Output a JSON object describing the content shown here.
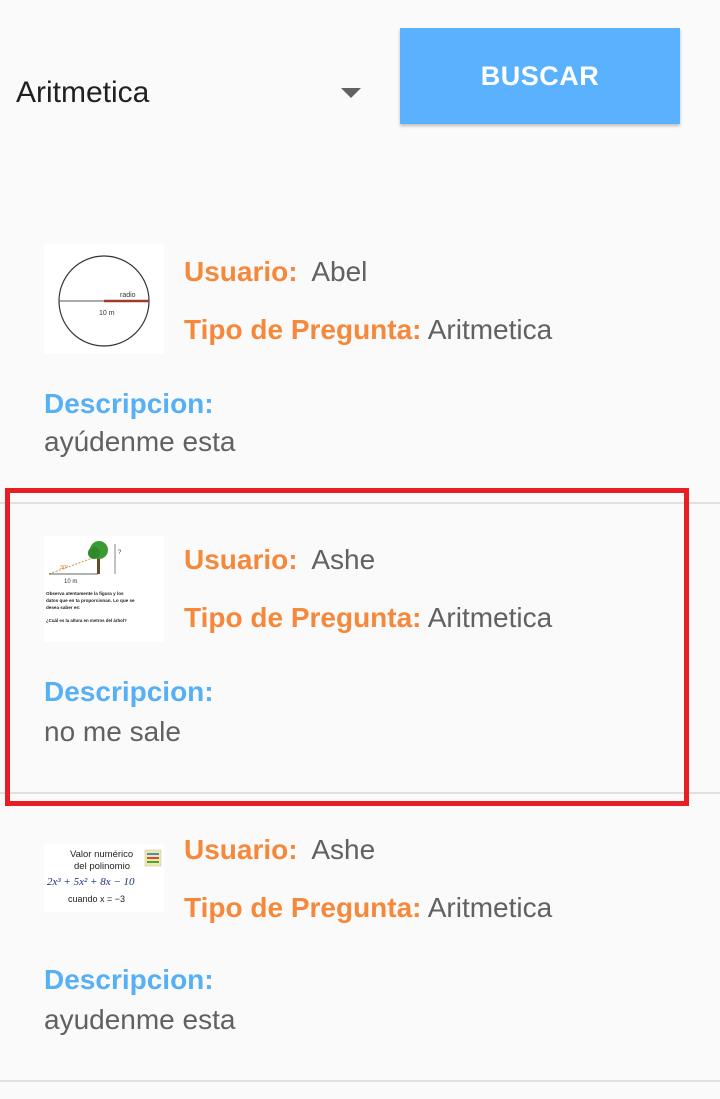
{
  "filter": {
    "selected": "Aritmetica",
    "button_label": "BUSCAR"
  },
  "labels": {
    "usuario": "Usuario:",
    "tipo": "Tipo de Pregunta:",
    "descripcion": "Descripcion:"
  },
  "posts": [
    {
      "usuario": "Abel",
      "tipo": "Aritmetica",
      "descripcion": "ayúdenme esta",
      "thumb_text": {
        "radio": "radio",
        "measure": "10 m"
      }
    },
    {
      "usuario": "Ashe",
      "tipo": "Aritmetica",
      "descripcion": "no me sale",
      "thumb_text": {
        "angle": "30°",
        "distance": "10 m",
        "question_mark": "?",
        "line1": "Observa atentamente la figura y los",
        "line2": "datos que en ta proporcionan. Lo que se",
        "line3": "desea saber es:",
        "line4": "¿Cuál es la altura en metros del árbol?"
      }
    },
    {
      "usuario": "Ashe",
      "tipo": "Aritmetica",
      "descripcion": "ayudenme esta",
      "thumb_text": {
        "line1": "Valor numérico",
        "line2": "del polinomio",
        "formula": "2x³ + 5x² + 8x − 10",
        "condition": "cuando  x = −3"
      }
    }
  ]
}
